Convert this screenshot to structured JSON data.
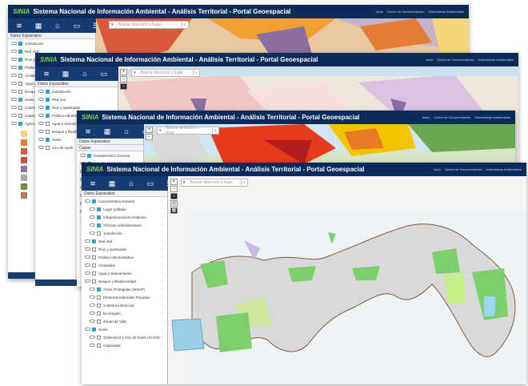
{
  "app": {
    "title": "Sistema Nacional de Información Ambiental - Análisis Territorial - Portal Geoespacial",
    "logo": "SINIA",
    "links": [
      "Inicio",
      "Centro de Documentación",
      "Estadísticas Ambientales"
    ]
  },
  "search": {
    "placeholder": "Buscar dirección o lugar"
  },
  "panel": {
    "title": "Datos Espaciales",
    "title_capas": "Capas",
    "w1": [
      "Jurisdicción",
      "Red Vial",
      "Ríos y quebradas",
      "Política Administrativa",
      "Amistades",
      "Agua y Saneamiento",
      "Bosque y Biodiversidad",
      "Suelo",
      "Cobertura",
      "Capacidad",
      "Agricultura"
    ],
    "w2": [
      "Jurisdicción",
      "Red Vial",
      "Ríos y quebradas",
      "Política Administrativa",
      "Agua y Saneamiento",
      "Bosque y Biodiversidad",
      "Suelo",
      "Uso de suelo"
    ],
    "w3": [
      "Característica General",
      "Jurisdicción",
      "Red Vial",
      "Ríos y quebradas",
      "Política Administrativa",
      "Agua y Saneamiento",
      "Bosque y Biodiversidad",
      "Suelo"
    ],
    "w4": [
      "Característica General",
      "Lugar poblado",
      "Infraestructura M Ambiente",
      "Oficinas Administrativas",
      "Jurisdicción",
      "Red Vial",
      "Ríos y quebradas",
      "Política Administrativa",
      "Amistades",
      "Agua y Saneamiento",
      "Bosque y Biodiversidad",
      "Áreas Protegidas (SINAP)",
      "Reservas Naturales Privadas",
      "Cobertura Boscosa",
      "Ecorregión",
      "Zonas de Vida",
      "Suelo",
      "Ordenanza y Uso de Suelo (CUSS)",
      "Capacidad"
    ]
  },
  "colors": {
    "header": "#0b2b5a",
    "toolbar": "#163c73",
    "accent": "#2ba3d8"
  }
}
